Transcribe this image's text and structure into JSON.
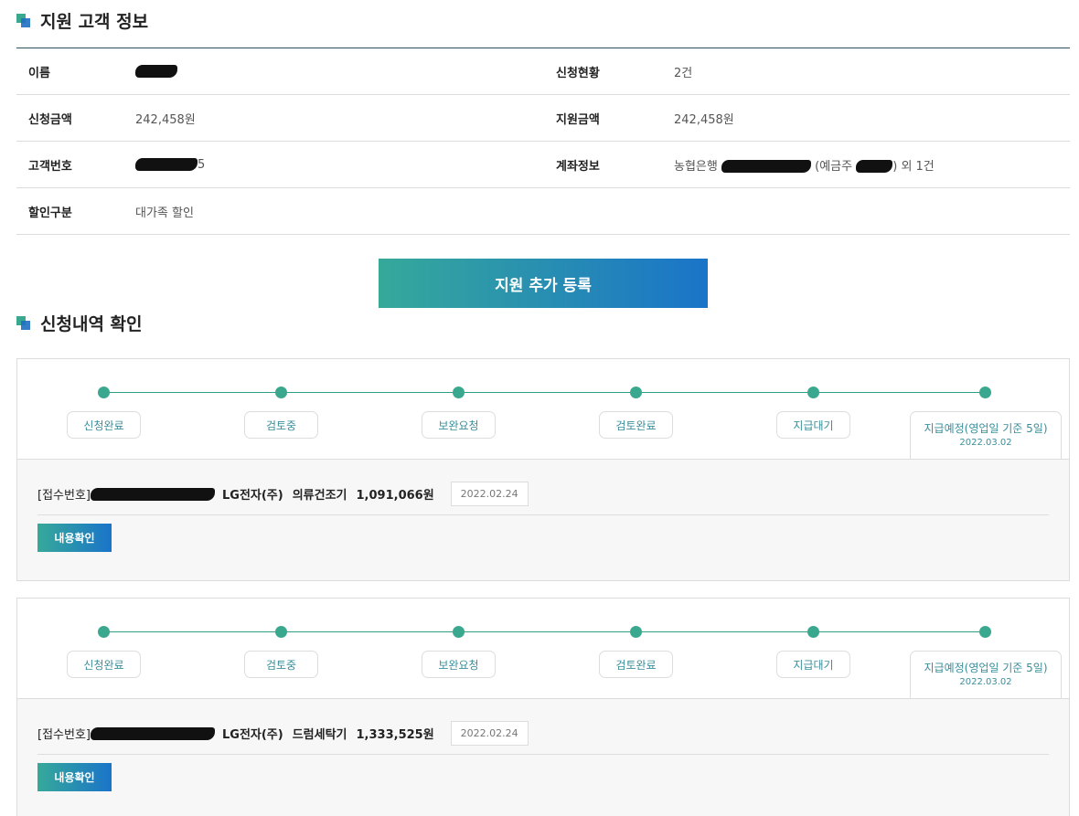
{
  "customer_section": {
    "title": "지원 고객 정보"
  },
  "customer_info": {
    "name_label": "이름",
    "status_label": "신청현황",
    "status_value": "2건",
    "apply_amount_label": "신청금액",
    "apply_amount_value": "242,458원",
    "support_amount_label": "지원금액",
    "support_amount_value": "242,458원",
    "customer_no_label": "고객번호",
    "customer_no_suffix": "5",
    "account_label": "계좌정보",
    "account_bank": "농협은행",
    "account_holder_prefix": "(예금주",
    "account_holder_suffix": ")",
    "account_extra": "외 1건",
    "discount_label": "할인구분",
    "discount_value": "대가족 할인"
  },
  "add_button": {
    "label": "지원 추가 등록"
  },
  "history_section": {
    "title": "신청내역 확인"
  },
  "steps": [
    "신청완료",
    "검토중",
    "보완요청",
    "검토완료",
    "지급대기",
    "지급예정(영업일 기준 5일)"
  ],
  "applications": [
    {
      "receipt_label": "[접수번호]",
      "company": "LG전자(주)",
      "product": "의류건조기",
      "amount": "1,091,066원",
      "date": "2022.02.24",
      "pay_date": "2022.03.02",
      "detail_button": "내용확인"
    },
    {
      "receipt_label": "[접수번호]",
      "company": "LG전자(주)",
      "product": "드럼세탁기",
      "amount": "1,333,525원",
      "date": "2022.02.24",
      "pay_date": "2022.03.02",
      "detail_button": "내용확인"
    }
  ],
  "colors": {
    "accent_green": "#3aa88f",
    "accent_blue": "#1a74c9",
    "border_dark": "#2f4f5f"
  }
}
